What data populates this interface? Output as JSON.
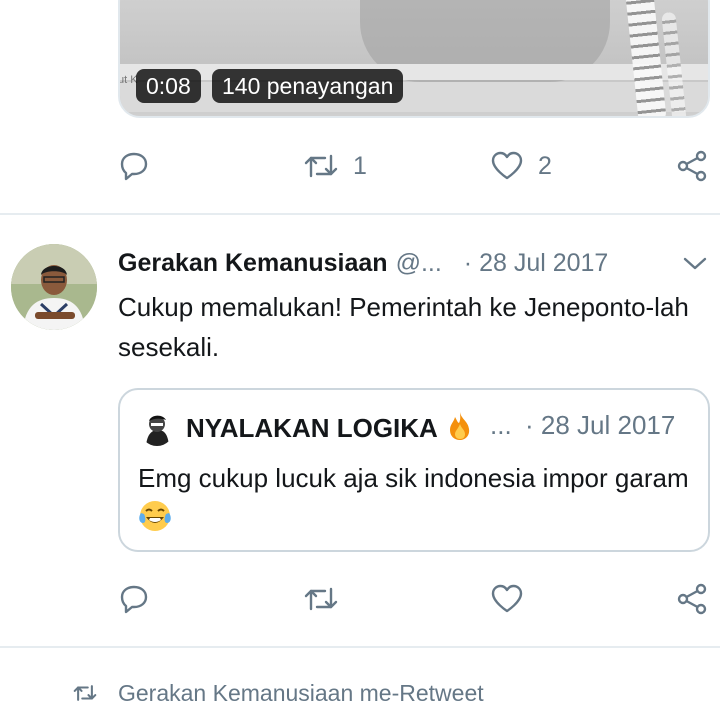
{
  "video": {
    "duration": "0:08",
    "views": "140 penayangan",
    "ghost_text": "ut K"
  },
  "top_actions": {
    "retweet_count": "1",
    "like_count": "2"
  },
  "tweet": {
    "author_name": "Gerakan Kemanusiaan",
    "handle": "@...",
    "date": "· 28 Jul 2017",
    "text": "Cukup memalukan! Pemerintah ke Jeneponto-lah sesekali."
  },
  "quoted_tweet": {
    "author_name": "NYALAKAN LOGIKA",
    "handle": "...",
    "date": "· 28 Jul 2017",
    "text": "Emg cukup lucuk aja sik indonesia impor garam"
  },
  "retweet_context": {
    "text": "Gerakan Kemanusiaan me-Retweet"
  },
  "icons": {
    "reply": "speech-bubble",
    "retweet": "retweet-arrows",
    "like": "heart-outline",
    "share": "share-nodes",
    "menu": "chevron-down",
    "name_emoji": "fire",
    "text_emoji": "tears-of-joy"
  },
  "colors": {
    "text": "#14171a",
    "secondary": "#657786",
    "border": "#ccd6dd",
    "divider": "#e6ecf0"
  }
}
